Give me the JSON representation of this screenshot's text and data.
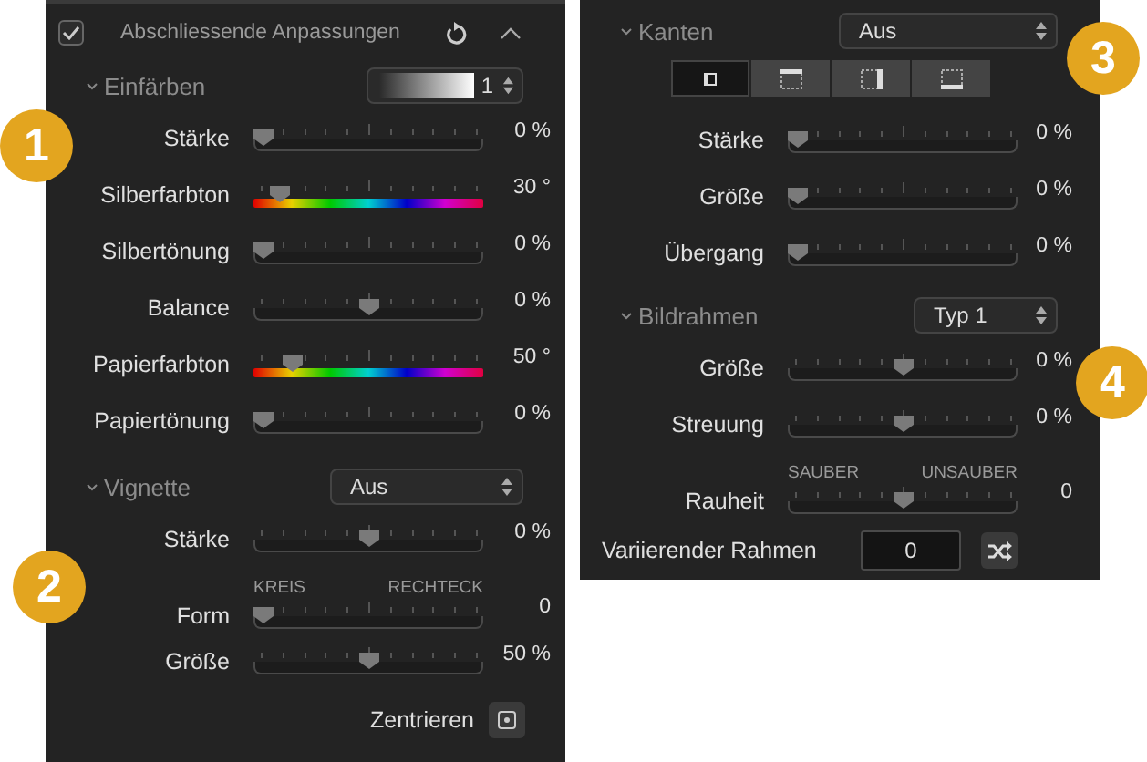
{
  "left_panel": {
    "header": {
      "checked": true,
      "title": "Abschliessende Anpassungen"
    },
    "sections": [
      {
        "title": "Einfärben",
        "expanded": true,
        "dropdown": {
          "kind": "gradient",
          "value": "1"
        },
        "rows": [
          {
            "kind": "slider",
            "label": "Stärke",
            "level": 0,
            "value": "0 %"
          },
          {
            "kind": "color_slider",
            "label": "Silberfarbton",
            "level": 0.08,
            "value": "30 °"
          },
          {
            "kind": "slider",
            "label": "Silbertönung",
            "level": 0,
            "value": "0 %"
          },
          {
            "kind": "slider",
            "label": "Balance",
            "level": 0.5,
            "value": "0 %"
          },
          {
            "kind": "color_slider",
            "label": "Papierfarbton",
            "level": 0.14,
            "value": "50 °"
          },
          {
            "kind": "slider",
            "label": "Papiertönung",
            "level": 0,
            "value": "0 %"
          }
        ]
      },
      {
        "title": "Vignette",
        "expanded": true,
        "dropdown": {
          "kind": "text",
          "value": "Aus"
        },
        "rows": [
          {
            "kind": "slider",
            "label": "Stärke",
            "level": 0.5,
            "value": "0 %"
          },
          {
            "kind": "slider",
            "label": "Form",
            "level": 0,
            "value": "0",
            "ends": [
              "KREIS",
              "RECHTECK"
            ]
          },
          {
            "kind": "slider",
            "label": "Größe",
            "level": 0.5,
            "value": "50 %"
          },
          {
            "kind": "button",
            "label": "Zentrieren"
          }
        ]
      }
    ]
  },
  "right_panel": {
    "sections": [
      {
        "title": "Kanten",
        "expanded": true,
        "dropdown": {
          "kind": "text",
          "value": "Aus"
        },
        "segments": [
          {
            "kind": "left",
            "selected": true
          },
          {
            "kind": "top",
            "selected": false
          },
          {
            "kind": "right",
            "selected": false
          },
          {
            "kind": "bottom",
            "selected": false
          }
        ],
        "rows": [
          {
            "kind": "slider",
            "label": "Stärke",
            "level": 0,
            "value": "0 %"
          },
          {
            "kind": "slider",
            "label": "Größe",
            "level": 0,
            "value": "0 %"
          },
          {
            "kind": "slider",
            "label": "Übergang",
            "level": 0,
            "value": "0 %"
          }
        ]
      },
      {
        "title": "Bildrahmen",
        "expanded": true,
        "dropdown": {
          "kind": "text",
          "value": "Typ 1"
        },
        "rows": [
          {
            "kind": "slider",
            "label": "Größe",
            "level": 0.5,
            "value": "0 %"
          },
          {
            "kind": "slider",
            "label": "Streuung",
            "level": 0.5,
            "value": "0 %"
          },
          {
            "kind": "slider",
            "label": "Rauheit",
            "level": 0.5,
            "value": "0",
            "ends": [
              "SAUBER",
              "UNSAUBER"
            ]
          },
          {
            "kind": "number",
            "label": "Variierender Rahmen",
            "value": "0"
          }
        ]
      }
    ]
  },
  "badges": [
    "1",
    "2",
    "3",
    "4"
  ]
}
